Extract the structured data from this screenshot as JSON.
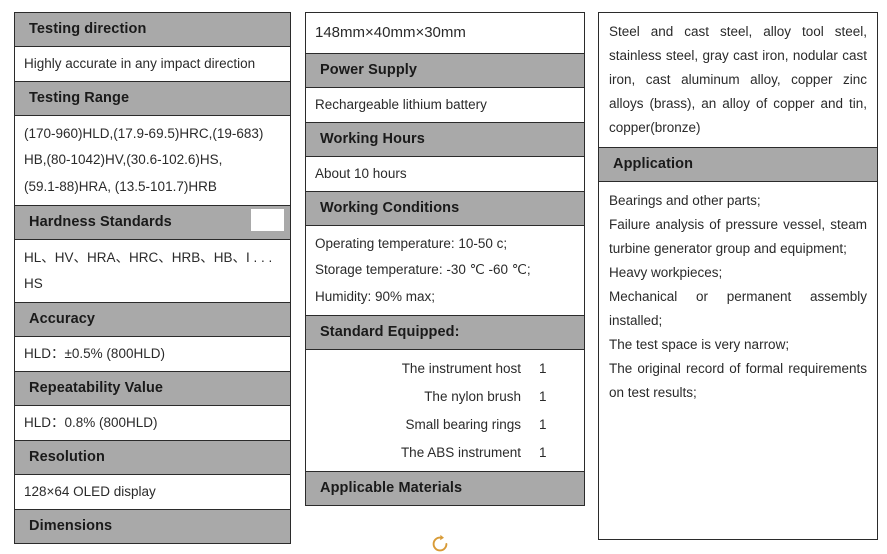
{
  "columns": [
    {
      "id": "column-1",
      "rows": [
        {
          "type": "header",
          "label": "Testing direction"
        },
        {
          "type": "value",
          "lines": [
            "Highly accurate in any impact direction"
          ]
        },
        {
          "type": "header",
          "label": "Testing Range"
        },
        {
          "type": "value",
          "lines": [
            "(170-960)HLD,(17.9-69.5)HRC,(19-683)",
            "HB,(80-1042)HV,(30.6-102.6)HS,",
            "(59.1-88)HRA, (13.5-101.7)HRB"
          ]
        },
        {
          "type": "header",
          "label": "Hardness Standards"
        },
        {
          "type": "value",
          "lines": [
            "HL、HV、HRA、HRC、HRB、HB、I . . .",
            "HS"
          ]
        },
        {
          "type": "header",
          "label": "Accuracy"
        },
        {
          "type": "value",
          "lines": [
            "HLD：±0.5% (800HLD)"
          ]
        },
        {
          "type": "header",
          "label": "Repeatability Value"
        },
        {
          "type": "value",
          "lines": [
            "HLD：0.8%    (800HLD)"
          ]
        },
        {
          "type": "header",
          "label": "Resolution"
        },
        {
          "type": "value",
          "lines": [
            "128×64 OLED display"
          ]
        },
        {
          "type": "header",
          "label": "Dimensions"
        }
      ]
    },
    {
      "id": "column-2",
      "rows": [
        {
          "type": "value",
          "lines": [
            "148mm×40mm×30mm"
          ]
        },
        {
          "type": "header",
          "label": "Power Supply"
        },
        {
          "type": "value",
          "lines": [
            "Rechargeable lithium battery"
          ]
        },
        {
          "type": "header",
          "label": "Working Hours"
        },
        {
          "type": "value",
          "lines": [
            "About 10 hours"
          ]
        },
        {
          "type": "header",
          "label": "Working Conditions"
        },
        {
          "type": "value",
          "lines": [
            "Operating temperature: 10-50 c;",
            "Storage temperature: -30 ℃ -60 ℃;",
            "Humidity: 90% max;"
          ]
        },
        {
          "type": "header",
          "label": "Standard Equipped:"
        },
        {
          "type": "equipment",
          "items": [
            {
              "name": "The instrument host",
              "qty": "1"
            },
            {
              "name": "The nylon brush",
              "qty": "1"
            },
            {
              "name": "Small bearing rings",
              "qty": "1"
            },
            {
              "name": "The ABS instrument",
              "qty": "1"
            }
          ]
        },
        {
          "type": "header",
          "label": "Applicable Materials"
        }
      ]
    },
    {
      "id": "column-3",
      "rows": [
        {
          "type": "value-justified",
          "lines": [
            "Steel and cast steel, alloy tool steel, stainless steel, gray cast iron, nodular cast iron, cast aluminum alloy, copper zinc alloys (brass), an alloy of copper and tin, copper(bronze)"
          ]
        },
        {
          "type": "header",
          "label": "Application"
        },
        {
          "type": "value-justified-multi",
          "lines": [
            "Bearings and other parts;",
            "Failure analysis of pressure vessel, steam turbine generator group and equipment;",
            "Heavy workpieces;",
            "Mechanical or permanent assembly installed;",
            "The test space is very narrow;",
            "The original record of formal requirements on test results;"
          ]
        }
      ]
    }
  ],
  "overlay": {
    "refresh_icon": "refresh-rotate-icon",
    "refresh_icon_color": "#d89b37"
  },
  "theme": {
    "header_background": "#a9a9a9",
    "border_color": "#2b2b2b",
    "text_color": "#2a2a2a",
    "page_background": "#ffffff"
  }
}
